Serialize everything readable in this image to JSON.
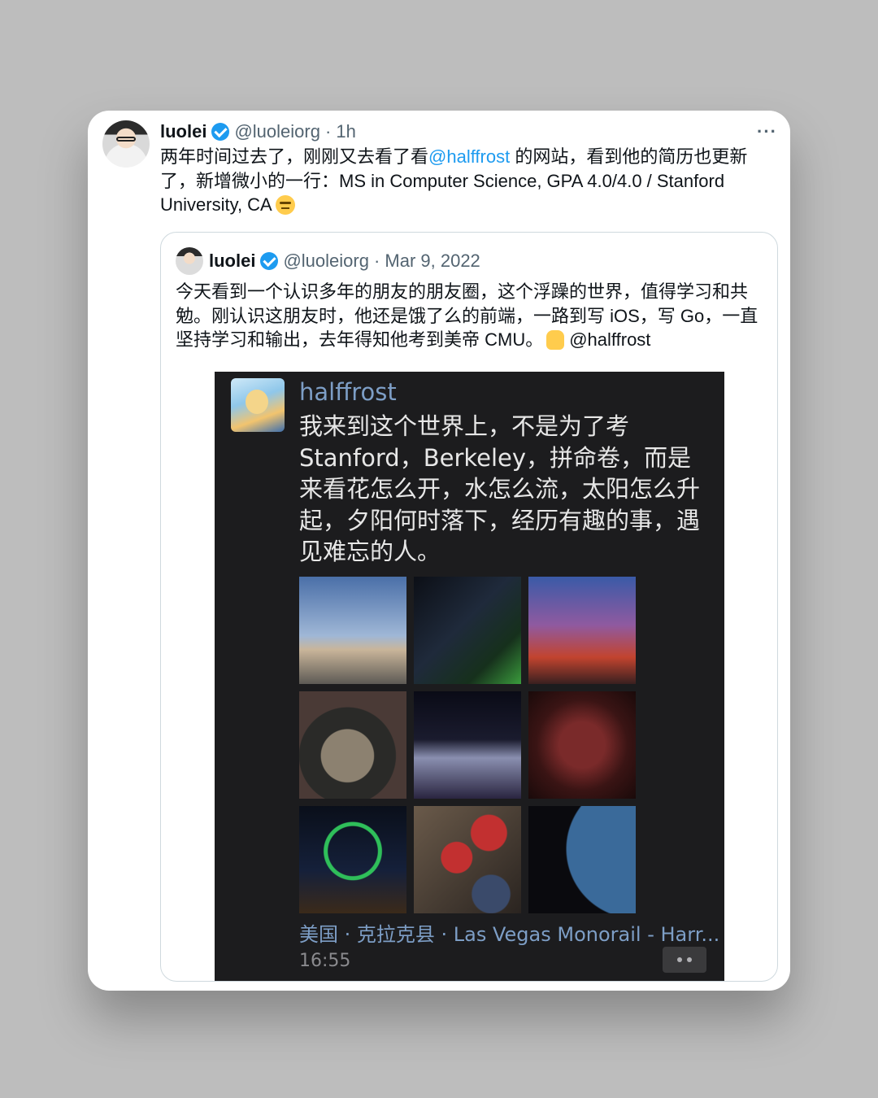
{
  "tweet": {
    "author": "luolei",
    "handle": "@luoleiorg",
    "time": "· 1h",
    "more": "···",
    "text_part1": "两年时间过去了，刚刚又去看了看",
    "mention": "@halffrost",
    "text_part2": " 的网站，看到他的简历也更新了，新增微小的一行：MS in Computer Science, GPA 4.0/4.0 / Stanford University, CA"
  },
  "quoted": {
    "author": "luolei",
    "handle": "@luoleiorg",
    "date": "· Mar 9, 2022",
    "text": "今天看到一个认识多年的朋友的朋友圈，这个浮躁的世界，值得学习和共勉。刚认识这朋友时，他还是饿了么的前端，一路到写 iOS，写 Go，一直坚持学习和输出，去年得知他考到美帝 CMU。",
    "mention": "@halffrost"
  },
  "moments": {
    "name": "halffrost",
    "text": "我来到这个世界上，不是为了考Stanford，Berkeley，拼命卷，而是来看花怎么开，水怎么流，太阳怎么升起，夕阳何时落下，经历有趣的事，遇见难忘的人。",
    "location": "美国 · 克拉克县 · Las Vegas Monorail - Harr...",
    "time": "16:55"
  },
  "colors": {
    "link": "#1d9bf0",
    "verified": "#1d9bf0",
    "moments_name": "#7d9ec6",
    "moments_bg": "#1c1c1e"
  }
}
